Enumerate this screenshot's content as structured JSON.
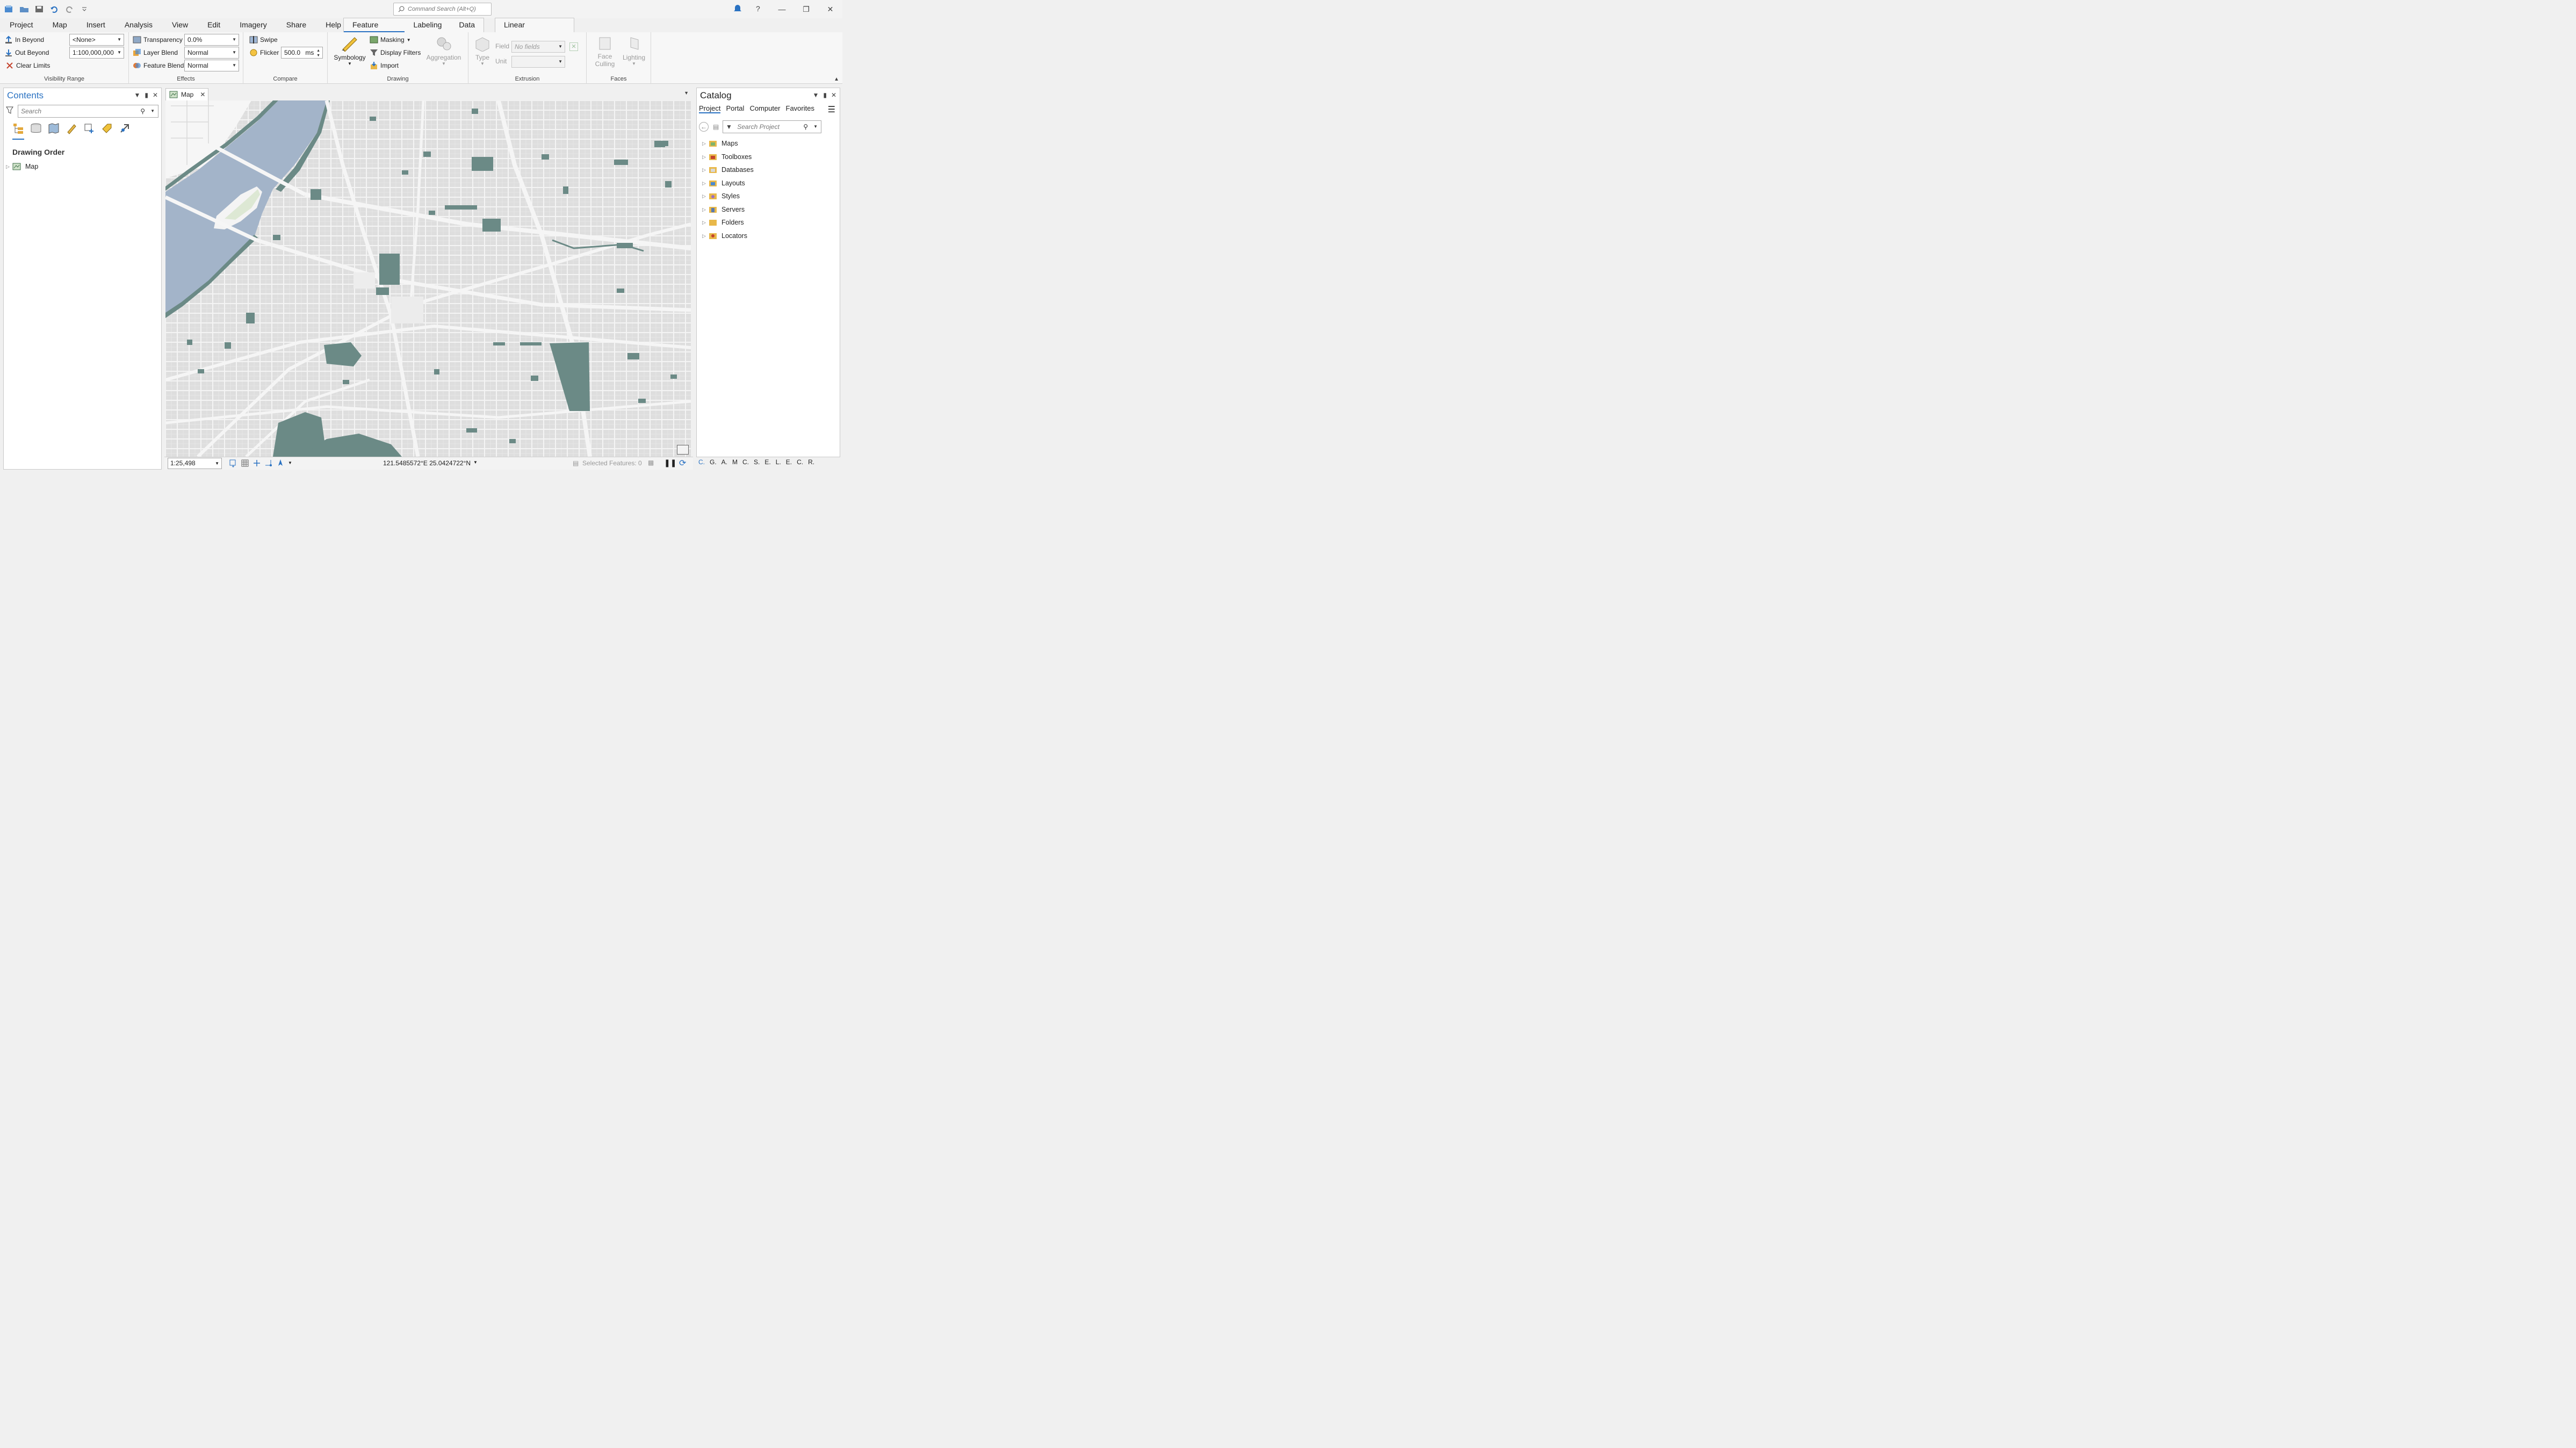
{
  "app": {
    "command_search_placeholder": "Command Search (Alt+Q)"
  },
  "menu": {
    "tabs": [
      "Project",
      "Map",
      "Insert",
      "Analysis",
      "View",
      "Edit",
      "Imagery",
      "Share",
      "Help"
    ],
    "context_tabs": [
      "Feature Layer",
      "Labeling",
      "Data"
    ],
    "active_context_tab": "Feature Layer",
    "linear_referencing": "Linear Referencing"
  },
  "ribbon": {
    "visibility_range": {
      "in_beyond": "In Beyond",
      "out_beyond": "Out Beyond",
      "clear_limits": "Clear Limits",
      "in_beyond_value": "<None>",
      "out_beyond_value": "1:100,000,000",
      "label": "Visibility Range"
    },
    "effects": {
      "transparency": "Transparency",
      "transparency_value": "0.0%",
      "layer_blend": "Layer Blend",
      "layer_blend_value": "Normal",
      "feature_blend": "Feature Blend",
      "feature_blend_value": "Normal",
      "label": "Effects"
    },
    "compare": {
      "swipe": "Swipe",
      "flicker": "Flicker",
      "flicker_value": "500.0",
      "flicker_unit": "ms",
      "label": "Compare"
    },
    "drawing": {
      "symbology": "Symbology",
      "masking": "Masking",
      "display_filters": "Display Filters",
      "import": "Import",
      "aggregation": "Aggregation",
      "label": "Drawing"
    },
    "extrusion": {
      "type": "Type",
      "field": "Field",
      "field_value": "No fields",
      "unit": "Unit",
      "label": "Extrusion"
    },
    "faces": {
      "face_culling_1": "Face",
      "face_culling_2": "Culling",
      "lighting": "Lighting",
      "label": "Faces"
    }
  },
  "contents": {
    "title": "Contents",
    "search_placeholder": "Search",
    "section": "Drawing Order",
    "items": [
      "Map"
    ]
  },
  "map": {
    "tab_label": "Map",
    "scale": "1:25,498",
    "coordinates": "121.5485572°E 25.0424722°N",
    "selected_features": "Selected Features: 0"
  },
  "catalog": {
    "title": "Catalog",
    "tabs": [
      "Project",
      "Portal",
      "Computer",
      "Favorites"
    ],
    "search_placeholder": "Search Project",
    "items": [
      "Maps",
      "Toolboxes",
      "Databases",
      "Layouts",
      "Styles",
      "Servers",
      "Folders",
      "Locators"
    ],
    "bottom_tabs": [
      "C.",
      "G.",
      "A.",
      "M",
      "C.",
      "S.",
      "E.",
      "L.",
      "E.",
      "C.",
      "R."
    ]
  },
  "colors": {
    "accent": "#2a72c2",
    "water": "#a3b4c9",
    "park": "#6b8a86",
    "land": "#dcdcdc",
    "road": "#f3f3f3"
  }
}
